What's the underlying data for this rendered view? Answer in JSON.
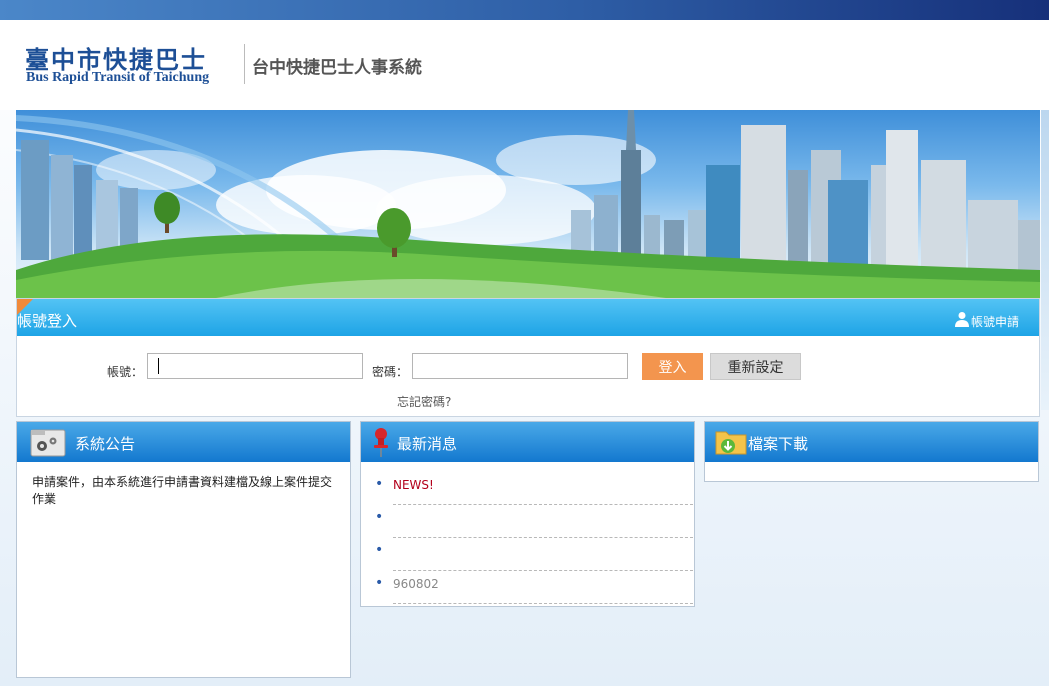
{
  "header": {
    "logo_zh": "臺中市快捷巴士",
    "logo_en": "Bus Rapid Transit of Taichung",
    "system_title": "台中快捷巴士人事系統"
  },
  "login": {
    "title": "帳號登入",
    "apply_label": "帳號申請",
    "account_label": "帳號：",
    "password_label": "密碼：",
    "account_value": "",
    "password_value": "",
    "login_button": "登入",
    "reset_button": "重新設定",
    "forgot_link": "忘記密碼?"
  },
  "notice": {
    "title": "系統公告",
    "icon": "gear-folder-icon",
    "text": "申請案件，由本系統進行申請書資料建檔及線上案件提交作業"
  },
  "news": {
    "title": "最新消息",
    "icon": "pushpin-icon",
    "items": [
      {
        "text": "NEWS!",
        "color": "#b3001b"
      },
      {
        "text": "",
        "color": "#333333"
      },
      {
        "text": "",
        "color": "#333333"
      },
      {
        "text": "960802",
        "color": "#888888"
      }
    ]
  },
  "downloads": {
    "title": "檔案下載",
    "icon": "download-folder-icon"
  },
  "colors": {
    "top_bar_dark": "#16307a",
    "login_header": "#1ea4e6",
    "login_button": "#f3954e",
    "panel_header": "#1378cf"
  }
}
